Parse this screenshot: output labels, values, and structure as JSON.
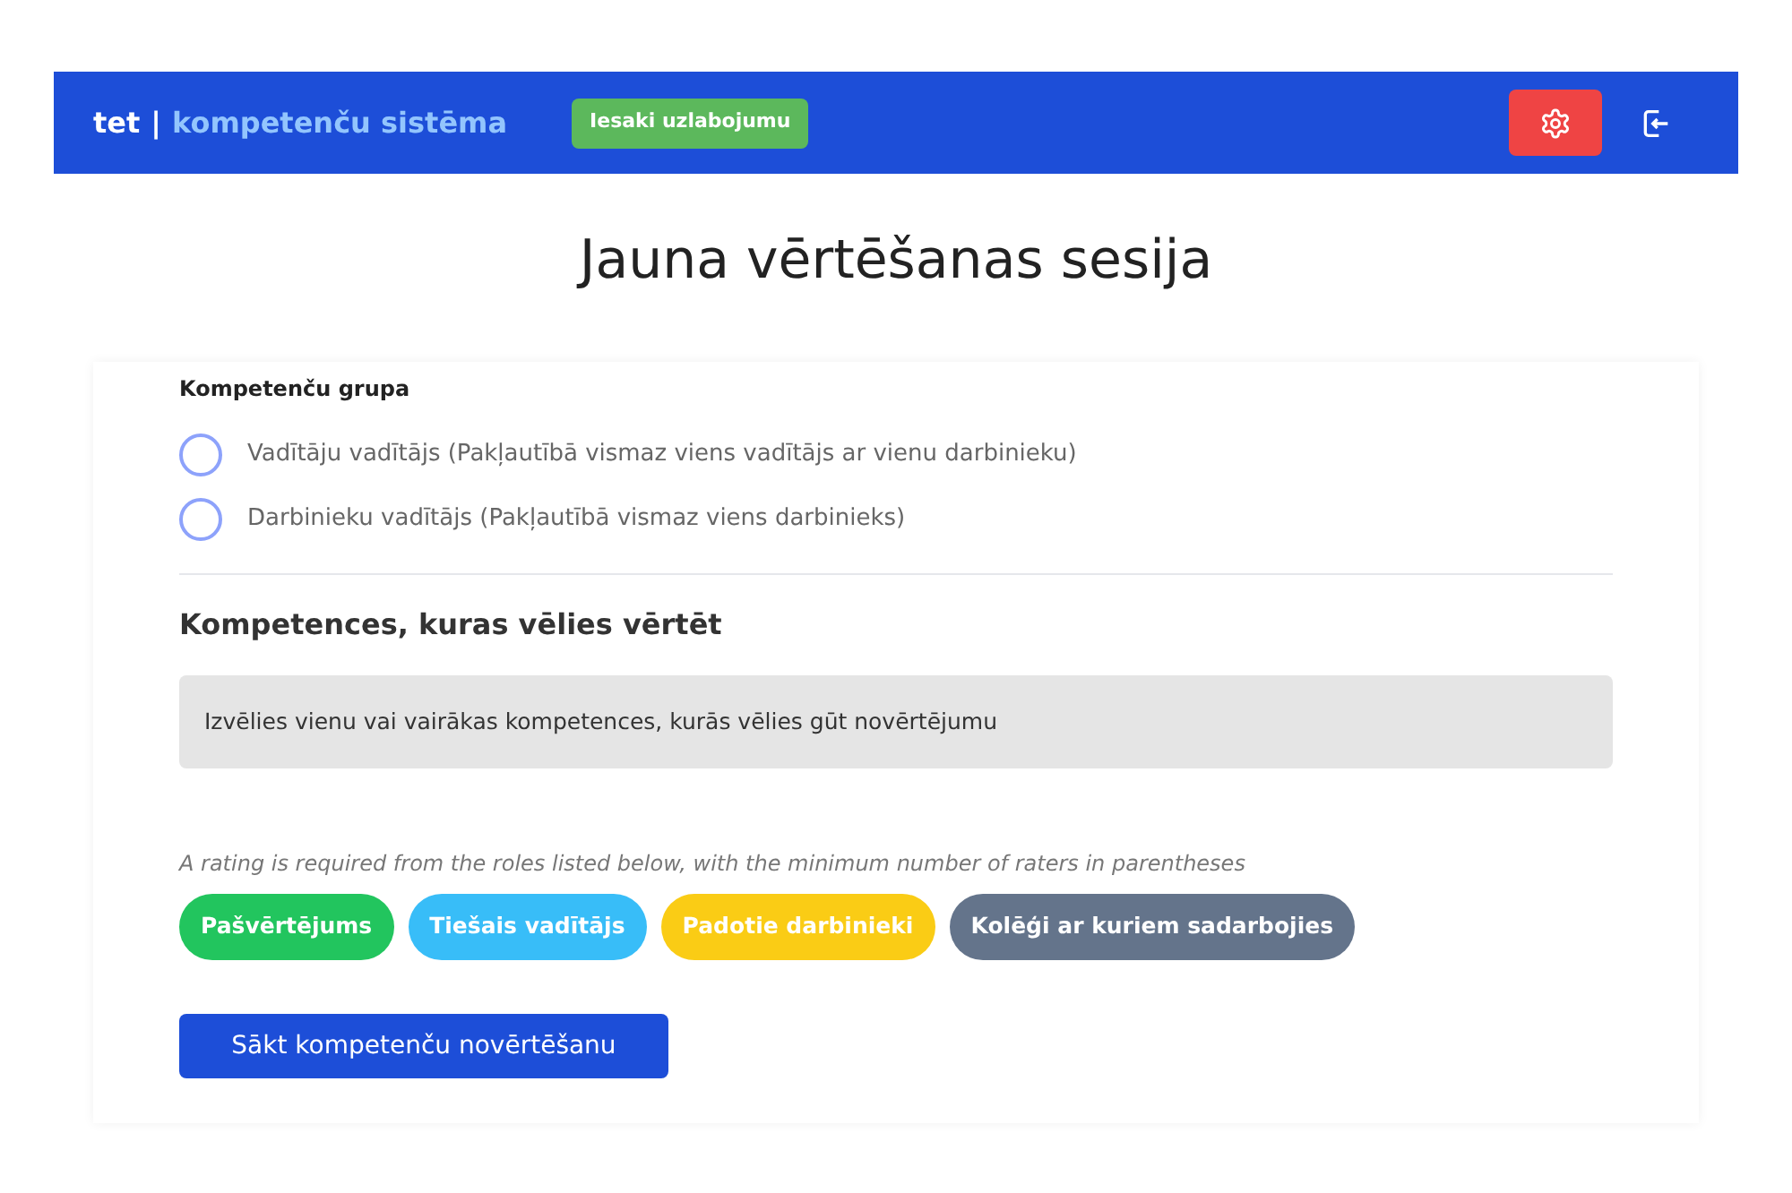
{
  "navbar": {
    "brand_short": "tet",
    "brand_separator": "|",
    "brand_name": "kompetenču sistēma",
    "feedback_button": "Iesaki uzlabojumu"
  },
  "title": "Jauna vērtēšanas sesija",
  "group": {
    "label": "Kompetenču grupa",
    "options": [
      {
        "label": "Vadītāju vadītājs (Pakļautībā vismaz viens vadītājs ar vienu darbinieku)",
        "selected": false
      },
      {
        "label": "Darbinieku vadītājs (Pakļautībā vismaz viens darbinieks)",
        "selected": false
      }
    ]
  },
  "competences": {
    "heading": "Kompetences, kuras vēlies vērtēt",
    "notice": "Izvēlies vienu vai vairākas kompetences, kurās vēlies gūt novērtējumu"
  },
  "roles": {
    "note": "A rating is required from the roles listed below, with the minimum number of raters in parentheses",
    "tags": [
      {
        "label": "Pašvērtējums",
        "color": "#22c55e"
      },
      {
        "label": "Tiešais vadītājs",
        "color": "#38bdf8"
      },
      {
        "label": "Padotie darbinieki",
        "color": "#facc15"
      },
      {
        "label": "Kolēģi ar kuriem sadarbojies",
        "color": "#64748b"
      }
    ]
  },
  "start_button": "Sākt kompetenču novērtēšanu"
}
